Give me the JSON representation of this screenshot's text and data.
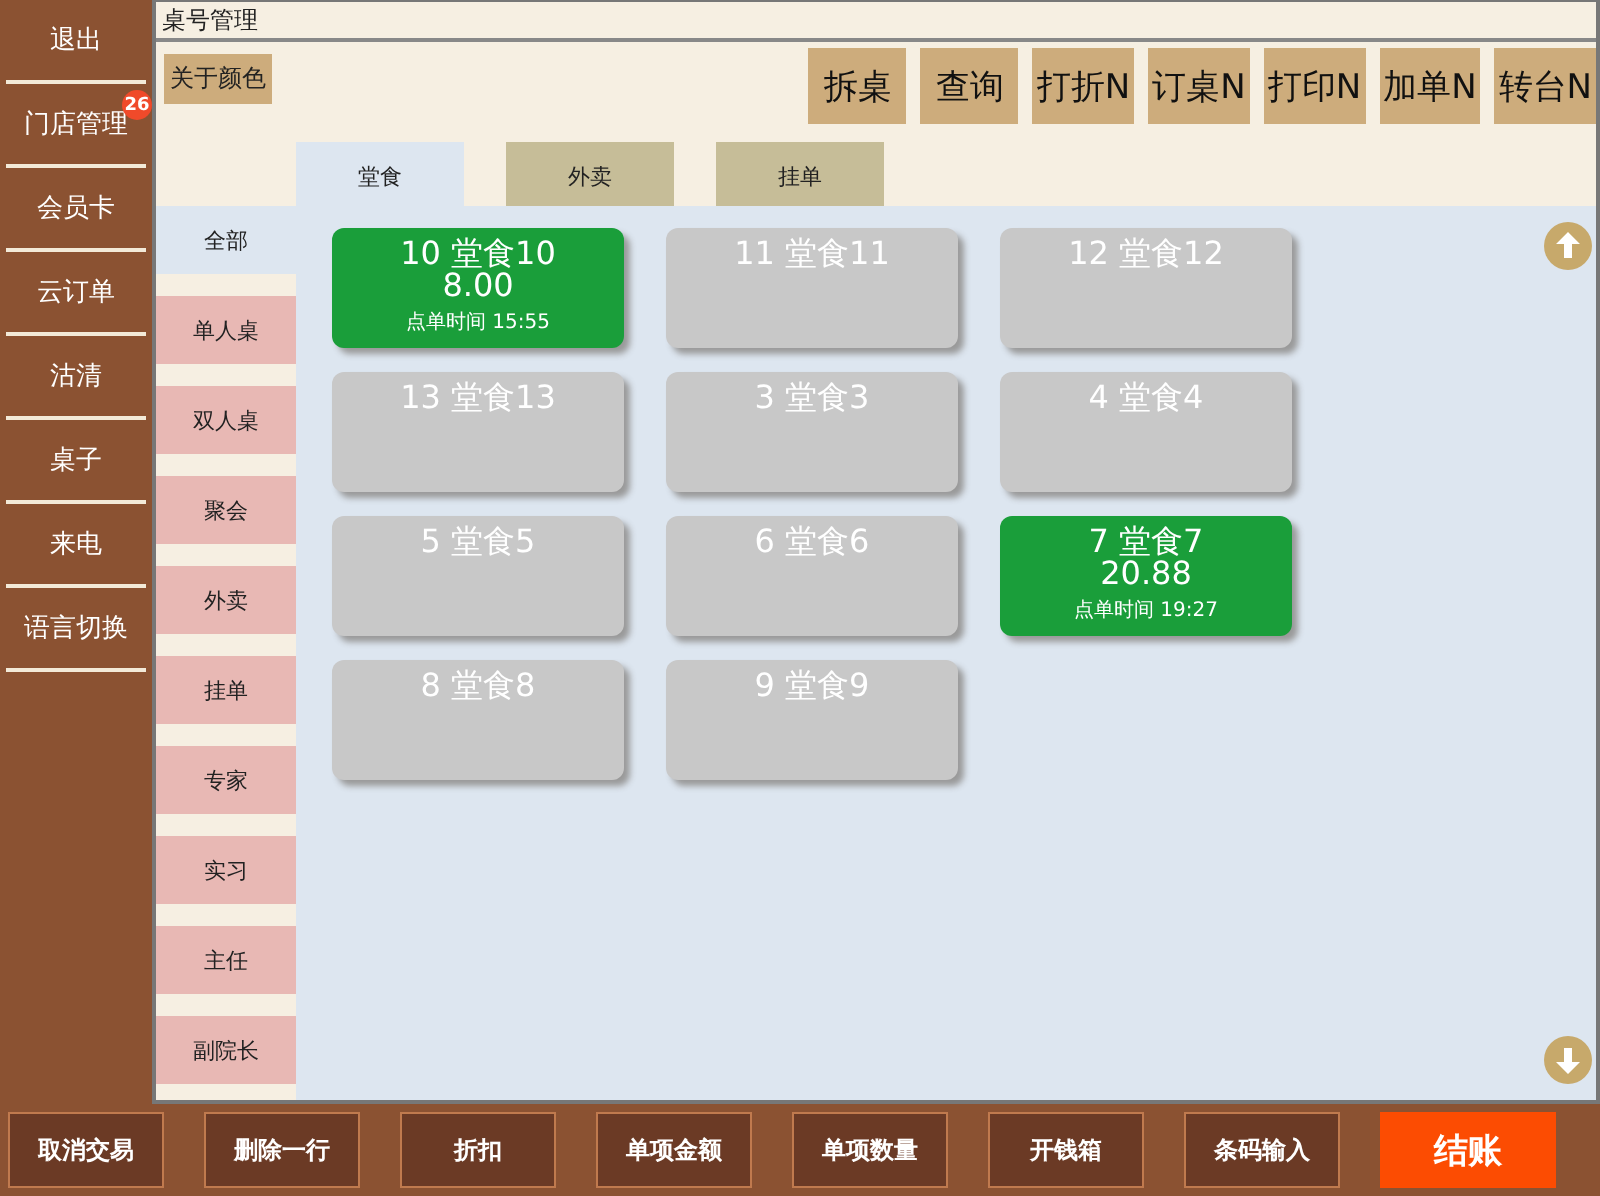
{
  "sidebar": {
    "items": [
      {
        "label": "退出"
      },
      {
        "label": "门店管理",
        "badge": "26"
      },
      {
        "label": "会员卡"
      },
      {
        "label": "云订单"
      },
      {
        "label": "沽清"
      },
      {
        "label": "桌子"
      },
      {
        "label": "来电"
      },
      {
        "label": "语言切换"
      }
    ]
  },
  "window": {
    "title": "桌号管理"
  },
  "toolbar": {
    "color_button": "关于颜色",
    "buttons": [
      "拆桌",
      "查询",
      "打折N",
      "订桌N",
      "打印N",
      "加单N",
      "转台N"
    ]
  },
  "tabs": [
    {
      "label": "堂食",
      "selected": true
    },
    {
      "label": "外卖",
      "selected": false
    },
    {
      "label": "挂单",
      "selected": false
    }
  ],
  "categories": [
    {
      "label": "全部",
      "selected": true
    },
    {
      "label": "单人桌",
      "selected": false
    },
    {
      "label": "双人桌",
      "selected": false
    },
    {
      "label": "聚会",
      "selected": false
    },
    {
      "label": "外卖",
      "selected": false
    },
    {
      "label": "挂单",
      "selected": false
    },
    {
      "label": "专家",
      "selected": false
    },
    {
      "label": "实习",
      "selected": false
    },
    {
      "label": "主任",
      "selected": false
    },
    {
      "label": "副院长",
      "selected": false
    }
  ],
  "tables": [
    {
      "name": "10 堂食10",
      "occupied": true,
      "amount": "8.00",
      "order_time": "点单时间 15:55"
    },
    {
      "name": "11 堂食11",
      "occupied": false
    },
    {
      "name": "12 堂食12",
      "occupied": false
    },
    {
      "name": "13 堂食13",
      "occupied": false
    },
    {
      "name": "3 堂食3",
      "occupied": false
    },
    {
      "name": "4 堂食4",
      "occupied": false
    },
    {
      "name": "5 堂食5",
      "occupied": false
    },
    {
      "name": "6 堂食6",
      "occupied": false
    },
    {
      "name": "7 堂食7",
      "occupied": true,
      "amount": "20.88",
      "order_time": "点单时间 19:27"
    },
    {
      "name": "8 堂食8",
      "occupied": false
    },
    {
      "name": "9 堂食9",
      "occupied": false
    }
  ],
  "bottom_bar": {
    "buttons": [
      {
        "label": "取消交易",
        "kind": "normal"
      },
      {
        "label": "删除一行",
        "kind": "normal"
      },
      {
        "label": "折扣",
        "kind": "normal"
      },
      {
        "label": "单项金额",
        "kind": "normal"
      },
      {
        "label": "单项数量",
        "kind": "normal"
      },
      {
        "label": "开钱箱",
        "kind": "normal"
      },
      {
        "label": "条码输入",
        "kind": "normal"
      },
      {
        "label": "结账",
        "kind": "primary"
      }
    ]
  }
}
